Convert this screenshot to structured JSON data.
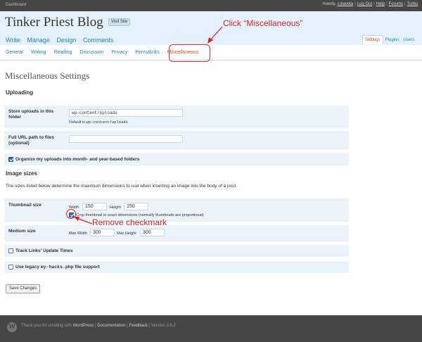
{
  "topbar": {
    "dashboard": "Dashboard",
    "howdy": "Howdy,",
    "user": "c.bavota",
    "links": [
      "Log Out",
      "Help",
      "Forums",
      "Turbo"
    ]
  },
  "header": {
    "blog_title": "Tinker Priest Blog",
    "visit_site": "Visit Site",
    "main_nav": [
      "Write",
      "Manage",
      "Design",
      "Comments"
    ],
    "right_nav": [
      "Settings",
      "Plugins",
      "Users"
    ]
  },
  "subnav": [
    "General",
    "Writing",
    "Reading",
    "Discussion",
    "Privacy",
    "Permalinks",
    "Miscellaneous"
  ],
  "annotations": {
    "click_misc": "Click “Miscellaneous”",
    "remove_checkmark": "Remove checkmark",
    "color": "#e02020"
  },
  "page": {
    "title": "Miscellaneous Settings",
    "uploading_heading": "Uploading",
    "store_uploads_label": "Store uploads in this folder",
    "store_uploads_value": "wp-content/uploads",
    "store_uploads_default_prefix": "Default is",
    "store_uploads_default_code": "wp-content/uploads",
    "full_url_label": "Full URL path to files (optional)",
    "full_url_value": "",
    "organize_label": "Organize my uploads into month- and year-based folders",
    "image_sizes_heading": "Image sizes",
    "image_sizes_desc": "The sizes listed below determine the maximum dimensions to use when inserting an image into the body of a post.",
    "thumbnail_label": "Thumbnail size",
    "width_label": "Width",
    "width_value": "150",
    "height_label": "Height",
    "height_value": "150",
    "crop_label": "Crop thumbnail to exact dimensions (normally thumbnails are proportional)",
    "medium_label": "Medium size",
    "max_width_label": "Max Width",
    "max_width_value": "300",
    "max_height_label": "Max Height",
    "max_height_value": "300",
    "track_links_label": "Track Links' Update Times",
    "legacy_prefix": "Use legacy",
    "legacy_code": "my-hacks.php",
    "legacy_suffix": "file support",
    "save_button": "Save Changes"
  },
  "footer": {
    "text": "Thank you for creating with",
    "wordpress": "WordPress",
    "documentation": "Documentation",
    "feedback": "Feedback",
    "version": "Version 2.6.2"
  }
}
